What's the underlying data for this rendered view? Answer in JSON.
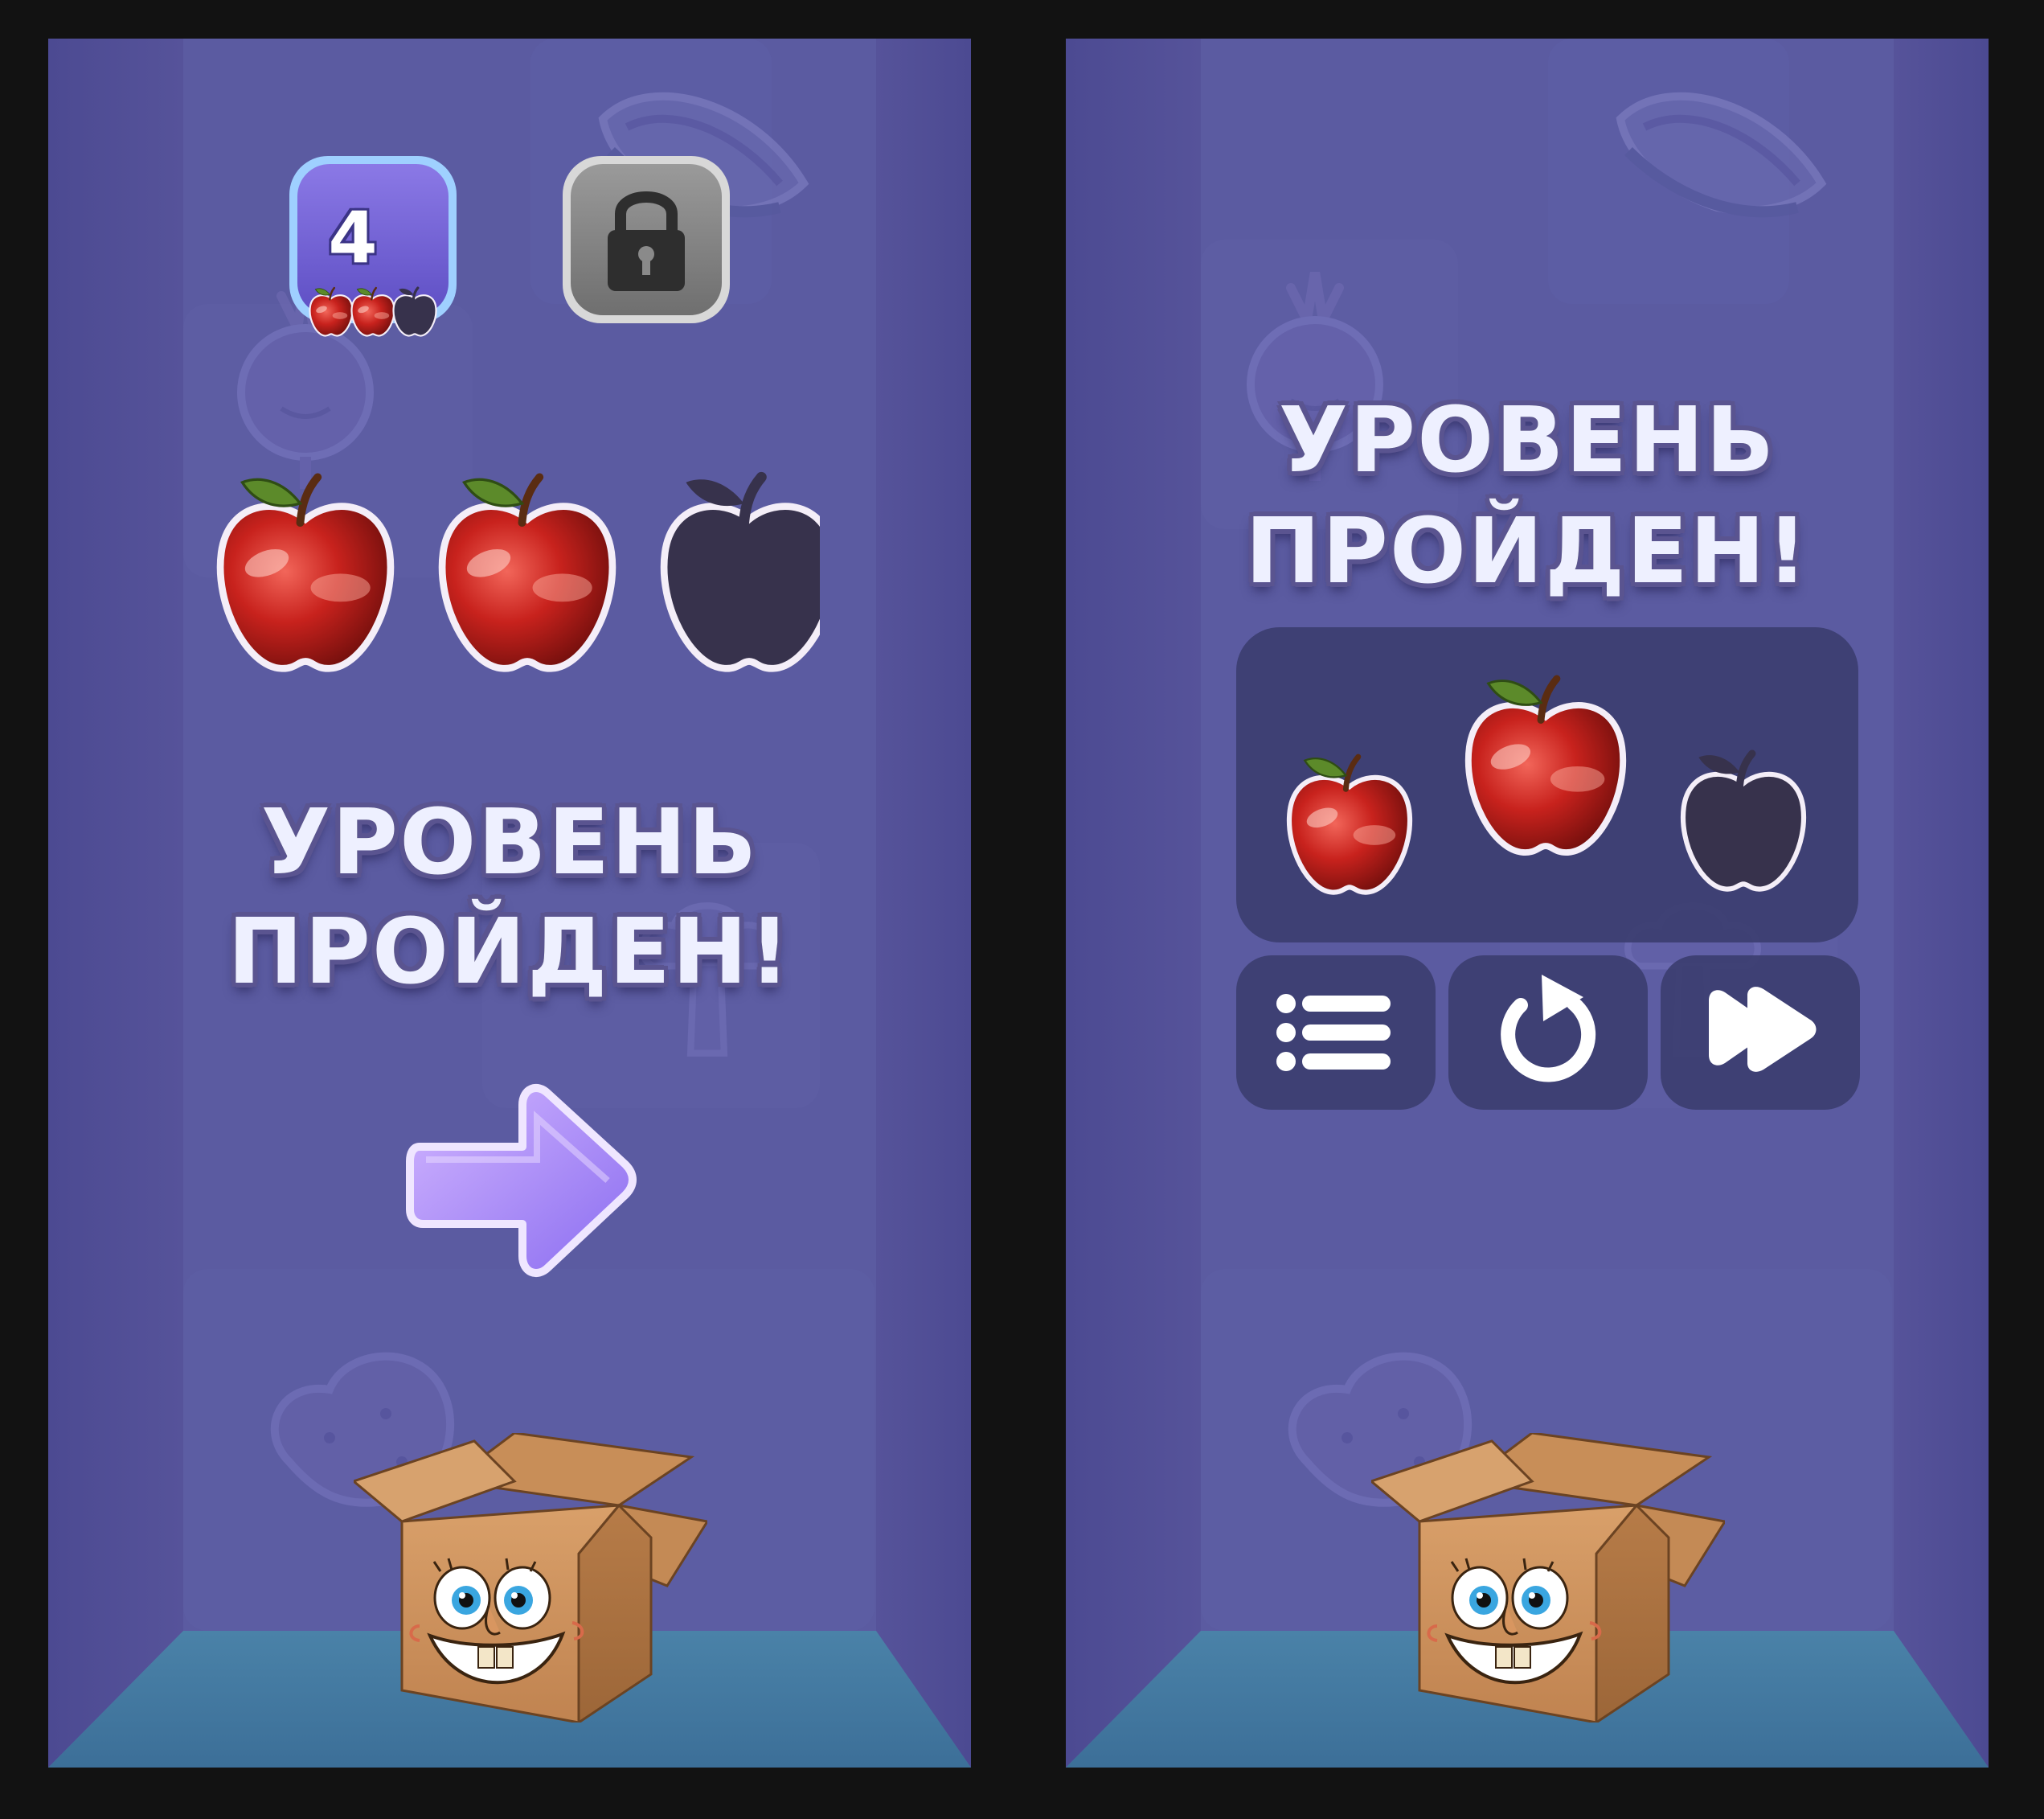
{
  "left_screen": {
    "level_tile": {
      "number": "4",
      "stars_earned": 2,
      "stars_total": 3
    },
    "locked_tile": {
      "icon": "lock-icon"
    },
    "apples": {
      "earned": 2,
      "total": 3
    },
    "title_line1": "УРОВЕНЬ",
    "title_line2": "ПРОЙДЕН!",
    "next_button": {
      "icon": "arrow-right-icon"
    },
    "mascot": "smiling-box"
  },
  "right_screen": {
    "title_line1": "УРОВЕНЬ",
    "title_line2": "ПРОЙДЕН!",
    "apples": {
      "earned": 2,
      "total": 3
    },
    "buttons": [
      {
        "icon": "list-menu-icon"
      },
      {
        "icon": "restart-icon"
      },
      {
        "icon": "next-level-icon"
      }
    ],
    "mascot": "smiling-box"
  },
  "colors": {
    "background": "#5a5aa0",
    "floor": "#3f7aa0",
    "panel": "#3a3d6e",
    "apple_red": "#c21f1c",
    "apple_empty": "#38324d",
    "arrow": "#b69bff",
    "level_tile": "#7a6ad8"
  }
}
